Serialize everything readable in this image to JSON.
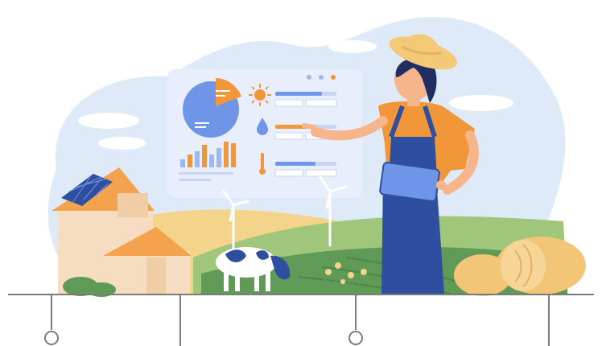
{
  "colors": {
    "sky_blob": "#dfeaf8",
    "dashboard_panel": "#e8eefb",
    "accent_blue": "#6f95e8",
    "accent_orange": "#f2963a",
    "overalls": "#2e4f9f",
    "shirt": "#f2963a",
    "skin": "#f7b58b",
    "hat": "#f3c877",
    "field_green": "#5f9a56",
    "field_green_light": "#9fc67a",
    "wheat": "#f4d48b",
    "house": "#f6dcc0",
    "roof": "#f4a24d",
    "hay": "#f3c577",
    "timeline": "#7b7b7b"
  },
  "icons": [
    "pie-chart-icon",
    "sun-icon",
    "water-drop-icon",
    "thermometer-icon",
    "solar-panel-icon",
    "wind-turbine-icon",
    "tablet-icon"
  ]
}
